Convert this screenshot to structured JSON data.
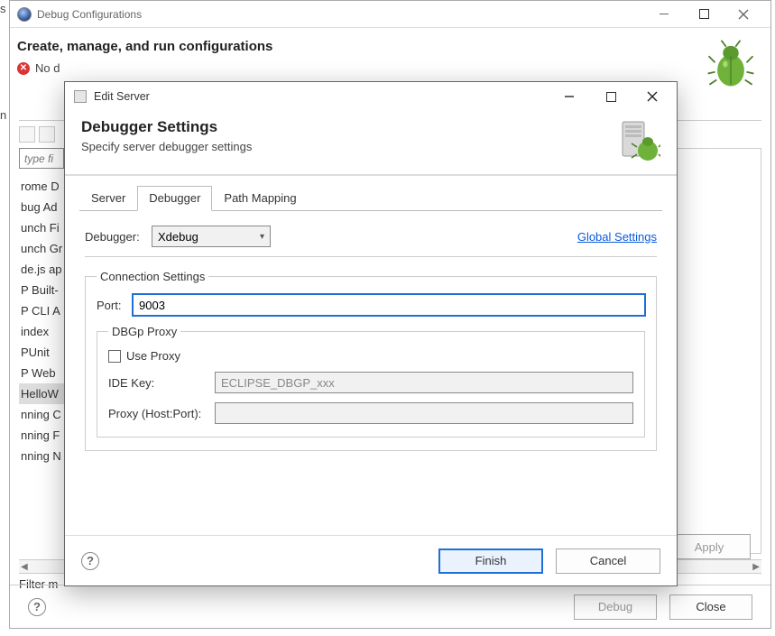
{
  "backWindow": {
    "title": "Debug Configurations",
    "heading": "Create, manage, and run configurations",
    "errorText": "No d",
    "filterPlaceholder": "type fi",
    "treeItems": [
      "rome D",
      "bug Ad",
      "unch Fi",
      "unch Gr",
      "de.js ap",
      "P Built-",
      "P CLI A",
      "index",
      "PUnit",
      "P Web",
      "HelloW",
      "nning C",
      "nning F",
      "nning N"
    ],
    "selectedTreeIndex": 10,
    "filterMatched": "Filter m",
    "buttons": {
      "apply": "Apply",
      "debug": "Debug",
      "close": "Close"
    }
  },
  "frontWindow": {
    "title": "Edit Server",
    "heading": "Debugger Settings",
    "subheading": "Specify server debugger settings",
    "tabs": [
      "Server",
      "Debugger",
      "Path Mapping"
    ],
    "activeTab": 1,
    "debuggerLabel": "Debugger:",
    "debuggerValue": "Xdebug",
    "globalSettings": "Global Settings",
    "conn": {
      "legend": "Connection Settings",
      "portLabel": "Port:",
      "portValue": "9003"
    },
    "proxy": {
      "legend": "DBGp Proxy",
      "useProxyLabel": "Use Proxy",
      "ideKeyLabel": "IDE Key:",
      "ideKeyValue": "ECLIPSE_DBGP_xxx",
      "hostLabel": "Proxy (Host:Port):",
      "hostValue": ""
    },
    "buttons": {
      "finish": "Finish",
      "cancel": "Cancel"
    }
  }
}
